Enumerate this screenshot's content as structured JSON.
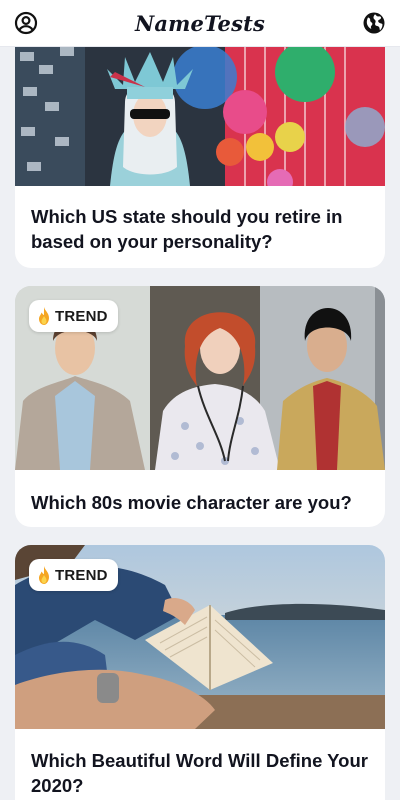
{
  "header": {
    "logo": "NameTests",
    "profile_icon": "user-circle-icon",
    "globe_icon": "globe-icon"
  },
  "feed": {
    "cards": [
      {
        "title": "Which US state should you retire in based on your personality?",
        "image": "Person dressed as Statue of Liberty with sunglasses in a colorful party decorations shop",
        "badge": null
      },
      {
        "title": "Which 80s movie character are you?",
        "image": "Three young actors posing in front of a brick wall in 80s clothing",
        "badge": "TREND"
      },
      {
        "title": "Which Beautiful Word Will Define Your 2020?",
        "image": "Person in jeans reading an open book by a lake",
        "badge": "TREND"
      }
    ]
  },
  "colors": {
    "background": "#eef0f4",
    "card": "#ffffff",
    "title_text": "#12141f",
    "badge_flame": "#f5a623"
  }
}
